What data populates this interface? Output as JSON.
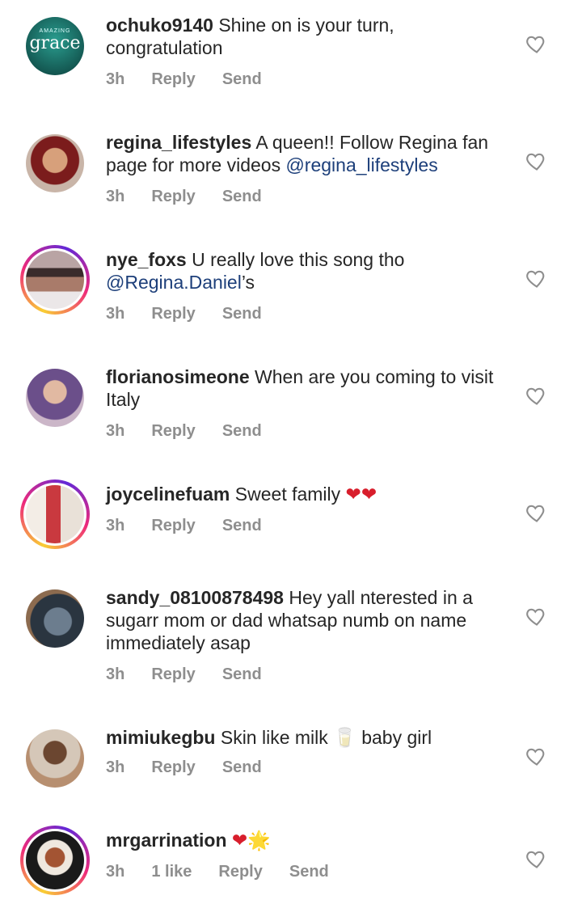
{
  "comments": [
    {
      "username": "ochuko9140",
      "text": "Shine on is your turn, congratulation",
      "time": "3h",
      "reply": "Reply",
      "send": "Send"
    },
    {
      "username": "regina_lifestyles",
      "text": "A queen!! Follow Regina fan page for more videos ",
      "mention": "@regina_lifestyles",
      "time": "3h",
      "reply": "Reply",
      "send": "Send"
    },
    {
      "username": "nye_foxs",
      "text": "U really love this song tho ",
      "mention": "@Regina.Daniel",
      "suffix": "’s",
      "time": "3h",
      "reply": "Reply",
      "send": "Send"
    },
    {
      "username": "florianosimeone",
      "text": "When are you coming to visit Italy",
      "time": "3h",
      "reply": "Reply",
      "send": "Send"
    },
    {
      "username": "joycelinefuam",
      "text": "Sweet family ",
      "emoji": "❤❤",
      "time": "3h",
      "reply": "Reply",
      "send": "Send"
    },
    {
      "username": "sandy_08100878498",
      "text": "Hey yall nterested in a sugarr mom or dad whatsap numb on name immediately asap",
      "time": "3h",
      "reply": "Reply",
      "send": "Send"
    },
    {
      "username": "mimiukegbu",
      "text": "Skin like milk ",
      "emoji": "🥛",
      "text2": " baby girl",
      "time": "3h",
      "reply": "Reply",
      "send": "Send"
    },
    {
      "username": "mrgarrination",
      "emoji": "❤🌟",
      "time": "3h",
      "likes": "1 like",
      "reply": "Reply",
      "send": "Send"
    }
  ],
  "avatar_badge": {
    "small": "AMAZING",
    "big": "grace"
  },
  "icons": {
    "like": "heart-outline-icon"
  },
  "colors": {
    "mention": "#1d3f7a",
    "meta": "#8e8e8e",
    "heart": "#d81e2c"
  }
}
